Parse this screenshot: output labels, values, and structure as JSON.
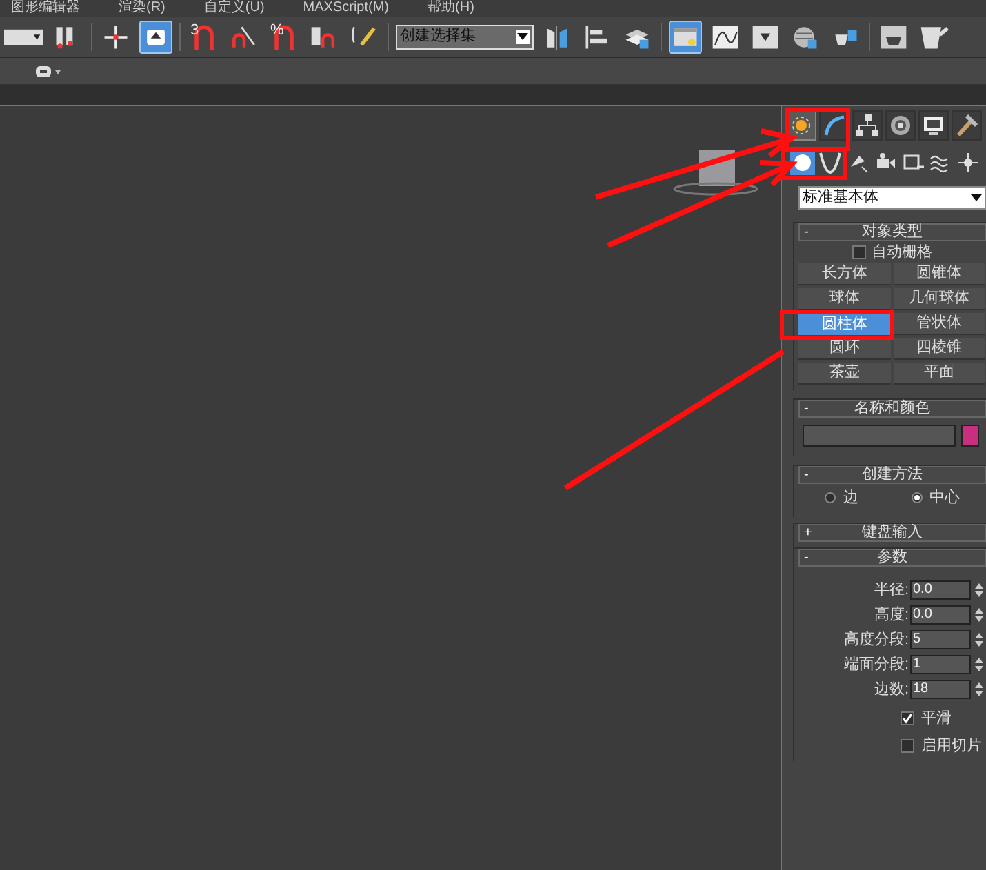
{
  "menu_bar": {
    "items": [
      "图形编辑器",
      "渲染(R)",
      "自定义(U)",
      "MAXScript(M)",
      "帮助(H)"
    ]
  },
  "toolbar": {
    "buttons": [
      {
        "kind": "dropdown-stub",
        "selected": false
      },
      {
        "kind": "bind",
        "selected": false
      },
      {
        "kind": "move",
        "selected": false
      },
      {
        "kind": "select-object",
        "selected": true
      },
      {
        "kind": "snap",
        "glyph": "3",
        "selected": false
      },
      {
        "kind": "angle-snap",
        "selected": false
      },
      {
        "kind": "percent-snap",
        "glyph": "%",
        "selected": false
      },
      {
        "kind": "spinner-snap",
        "selected": false
      },
      {
        "kind": "edit-named",
        "selected": false
      },
      {
        "kind": "selection-set",
        "value": "创建选择集"
      },
      {
        "kind": "mirror",
        "selected": false
      },
      {
        "kind": "align",
        "selected": false
      },
      {
        "kind": "layers",
        "selected": false
      },
      {
        "kind": "scene-explorer",
        "selected": true
      },
      {
        "kind": "curve-editor",
        "selected": false
      },
      {
        "kind": "schematic",
        "selected": false
      },
      {
        "kind": "material",
        "selected": false
      },
      {
        "kind": "render-setup",
        "selected": false
      },
      {
        "kind": "render-frame",
        "selected": false
      },
      {
        "kind": "render",
        "selected": false
      }
    ]
  },
  "command_panel": {
    "tabs": [
      {
        "kind": "create",
        "selected": true
      },
      {
        "kind": "modify",
        "selected": false
      },
      {
        "kind": "hierarchy",
        "selected": false
      },
      {
        "kind": "motion",
        "selected": false
      },
      {
        "kind": "display",
        "selected": false
      },
      {
        "kind": "utilities",
        "selected": false
      }
    ],
    "subtabs": [
      {
        "kind": "geometry",
        "selected": true
      },
      {
        "kind": "shapes",
        "selected": false
      },
      {
        "kind": "lights",
        "selected": false
      },
      {
        "kind": "cameras",
        "selected": false
      },
      {
        "kind": "helpers",
        "selected": false
      },
      {
        "kind": "spacewarps",
        "selected": false
      },
      {
        "kind": "systems",
        "selected": false
      }
    ],
    "category": "标准基本体",
    "object_type": {
      "toggle": "-",
      "title": "对象类型",
      "auto_grid": {
        "label": "自动栅格",
        "checked": false
      },
      "buttons": [
        {
          "label": "长方体",
          "selected": false
        },
        {
          "label": "圆锥体",
          "selected": false
        },
        {
          "label": "球体",
          "selected": false
        },
        {
          "label": "几何球体",
          "selected": false
        },
        {
          "label": "圆柱体",
          "selected": true
        },
        {
          "label": "管状体",
          "selected": false
        },
        {
          "label": "圆环",
          "selected": false
        },
        {
          "label": "四棱锥",
          "selected": false
        },
        {
          "label": "茶壶",
          "selected": false
        },
        {
          "label": "平面",
          "selected": false
        }
      ]
    },
    "name_and_color": {
      "toggle": "-",
      "title": "名称和颜色",
      "color": "#c8307f"
    },
    "creation_method": {
      "toggle": "-",
      "title": "创建方法",
      "options": [
        {
          "label": "边",
          "selected": false
        },
        {
          "label": "中心",
          "selected": true
        }
      ]
    },
    "keyboard_entry": {
      "toggle": "+",
      "title": "键盘输入"
    },
    "parameters": {
      "toggle": "-",
      "title": "参数",
      "fields": [
        {
          "label": "半径:",
          "value": "0.0"
        },
        {
          "label": "高度:",
          "value": "0.0"
        },
        {
          "label": "高度分段:",
          "value": "5"
        },
        {
          "label": "端面分段:",
          "value": "1"
        },
        {
          "label": "边数:",
          "value": "18"
        }
      ],
      "checkboxes": [
        {
          "label": "平滑",
          "checked": true
        },
        {
          "label": "启用切片",
          "checked": false
        }
      ]
    }
  }
}
